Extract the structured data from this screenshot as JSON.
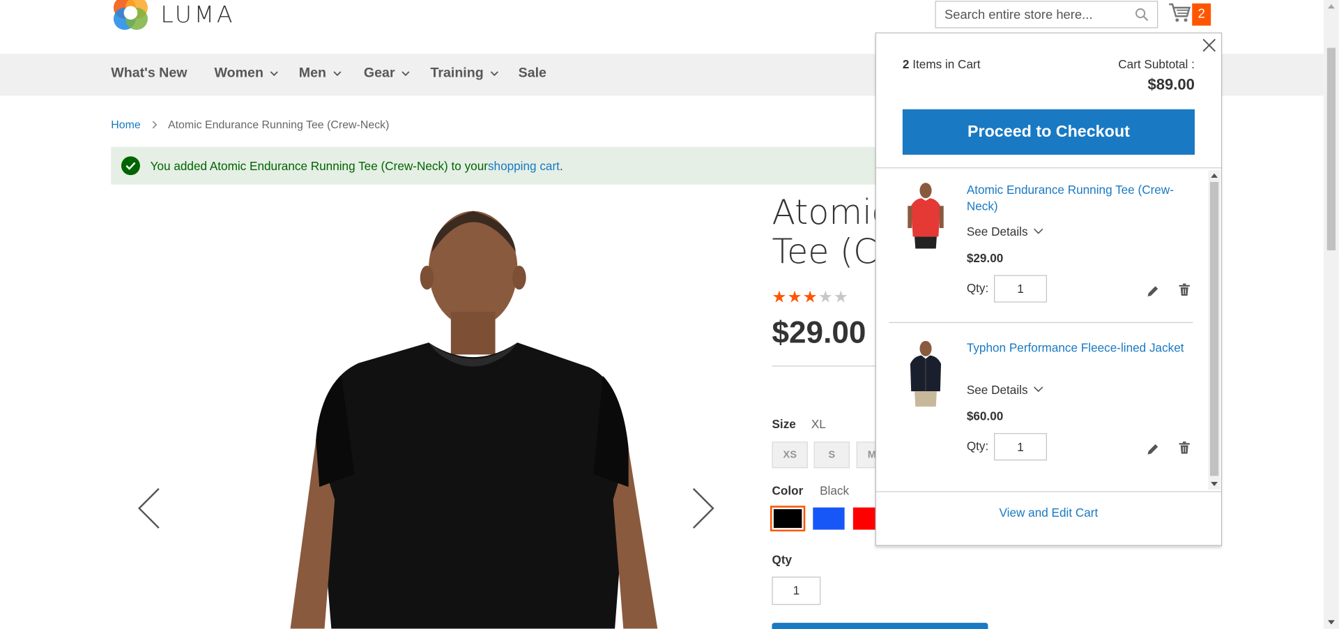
{
  "brand": {
    "name": "LUMA"
  },
  "search": {
    "placeholder": "Search entire store here..."
  },
  "minicart": {
    "count": "2"
  },
  "nav": {
    "items": [
      {
        "label": "What's New"
      },
      {
        "label": "Women"
      },
      {
        "label": "Men"
      },
      {
        "label": "Gear"
      },
      {
        "label": "Training"
      },
      {
        "label": "Sale"
      }
    ]
  },
  "breadcrumb": {
    "home": "Home",
    "current": "Atomic Endurance Running Tee (Crew-Neck)"
  },
  "message": {
    "prefix": "You added Atomic Endurance Running Tee (Crew-Neck) to your ",
    "link": "shopping cart",
    "suffix": "."
  },
  "product": {
    "title_line1": "Atomic",
    "title_line2": "Tee (Cr",
    "rating": 3,
    "rating_max": 5,
    "price": "$29.00",
    "size_label": "Size",
    "size_value": "XL",
    "sizes": [
      "XS",
      "S",
      "M"
    ],
    "color_label": "Color",
    "color_value": "Black",
    "colors": [
      "#000000",
      "#1857f7",
      "#ff0000"
    ],
    "qty_label": "Qty",
    "qty_value": "1"
  },
  "dropdown": {
    "count": "2",
    "count_label": " Items in Cart",
    "subtotal_label": "Cart Subtotal :",
    "subtotal": "$89.00",
    "checkout_label": "Proceed to Checkout",
    "see_details": "See Details",
    "qty_label": "Qty:",
    "view_cart": "View and Edit Cart",
    "items": [
      {
        "name": "Atomic Endurance Running Tee (Crew-Neck)",
        "price": "$29.00",
        "qty": "1"
      },
      {
        "name": "Typhon Performance Fleece-lined Jacket",
        "price": "$60.00",
        "qty": "1"
      }
    ]
  },
  "colors": {
    "accent": "#1979c3",
    "badge": "#ff5501",
    "success_bg": "#e5efe5",
    "success_text": "#006400"
  }
}
